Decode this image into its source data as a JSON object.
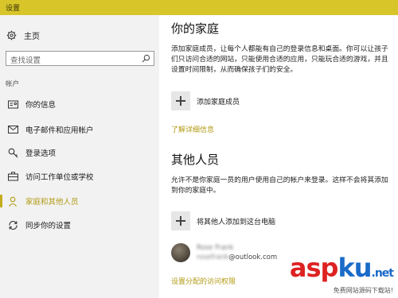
{
  "window": {
    "title": "设置"
  },
  "sidebar": {
    "home_label": "主页",
    "search_placeholder": "查找设置",
    "section_label": "帐户",
    "items": [
      {
        "label": "你的信息",
        "icon": "id-card-icon"
      },
      {
        "label": "电子邮件和应用帐户",
        "icon": "mail-icon"
      },
      {
        "label": "登录选项",
        "icon": "key-icon"
      },
      {
        "label": "访问工作单位或学校",
        "icon": "briefcase-icon"
      },
      {
        "label": "家庭和其他人员",
        "icon": "person-icon",
        "active": true
      },
      {
        "label": "同步你的设置",
        "icon": "sync-icon"
      }
    ]
  },
  "family": {
    "heading": "你的家庭",
    "description": "添加家庭成员，让每个人都能有自己的登录信息和桌面。你可以让孩子们只访问合适的网站，只能使用合适的应用，只能玩合适的游戏，并且设置时间限制，从而确保孩子们的安全。",
    "add_label": "添加家庭成员",
    "learn_more_link": "了解详细信息"
  },
  "others": {
    "heading": "其他人员",
    "description": "允许不是你家庭一员的用户使用自己的帐户来登录。这样不会将其添加到你的家庭中。",
    "add_label": "将其他人添加到这台电脑",
    "user": {
      "name_blurred": "Rose Frank",
      "email_blurred": "rosefrank",
      "email_domain": "@outlook.com"
    },
    "assigned_access_link": "设置分配的访问权限"
  },
  "watermark": {
    "brand_a": "asp",
    "brand_b": "ku",
    "suffix": ".net",
    "subtitle": "免费网站源码下载站!"
  },
  "colors": {
    "titlebar": "#d8c52a",
    "accent": "#b29a13",
    "sidebar_bg": "#f2f2f2"
  }
}
